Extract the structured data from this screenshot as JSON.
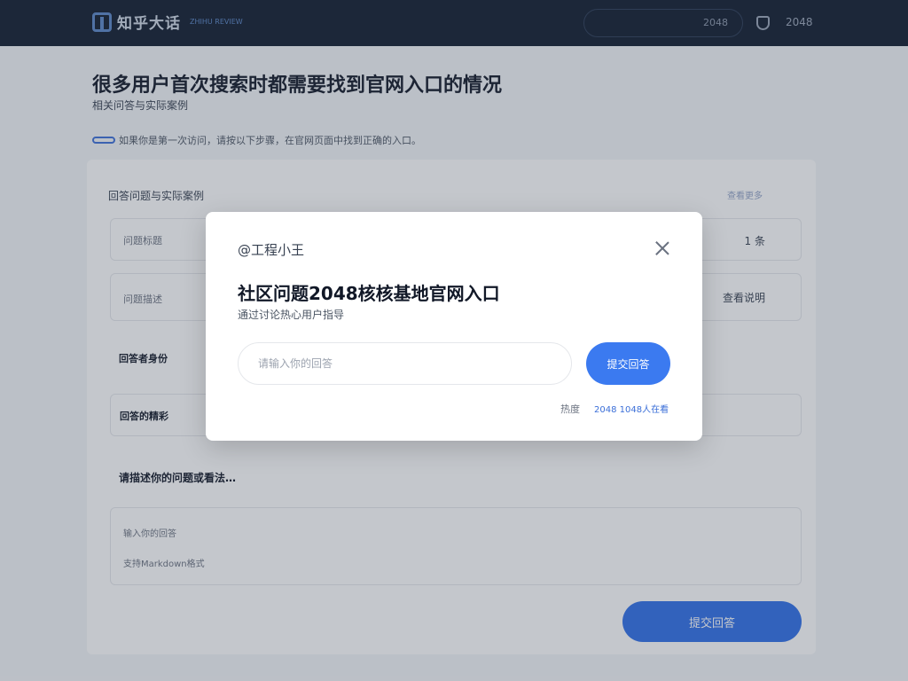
{
  "header": {
    "logo_text": "知乎大话",
    "logo_sub": "ZHIHU REVIEW",
    "search_value": "2048",
    "top_link": "2048"
  },
  "page": {
    "title": "很多用户首次搜索时都需要找到官网入口的情况",
    "subtitle": "相关问答与实际案例",
    "notice": "如果你是第一次访问，请按以下步骤，在官网页面中找到正确的入口。"
  },
  "card": {
    "title": "回答问题与实际案例",
    "link": "查看更多",
    "rows": [
      {
        "label": "问题标题",
        "right": "1 条"
      },
      {
        "label": "问题描述",
        "right": "查看说明"
      },
      {
        "label": "回答者身份",
        "right": ""
      },
      {
        "label": "回答的精彩",
        "right": ""
      }
    ],
    "section_heading": "请描述你的问题或看法…",
    "textarea_lines": [
      "输入你的回答",
      "支持Markdown格式"
    ],
    "submit_label": "提交回答"
  },
  "modal": {
    "author": "@工程小王",
    "title": "社区问题2048核核基地官网入口",
    "desc": "通过讨论热心用户指导",
    "input_placeholder": "请输入你的回答",
    "button_label": "提交回答",
    "foot_label": "热度",
    "foot_value": "2048 1048人在看"
  },
  "colors": {
    "accent": "#3b7af0",
    "topbar": "#0f1b2d"
  }
}
